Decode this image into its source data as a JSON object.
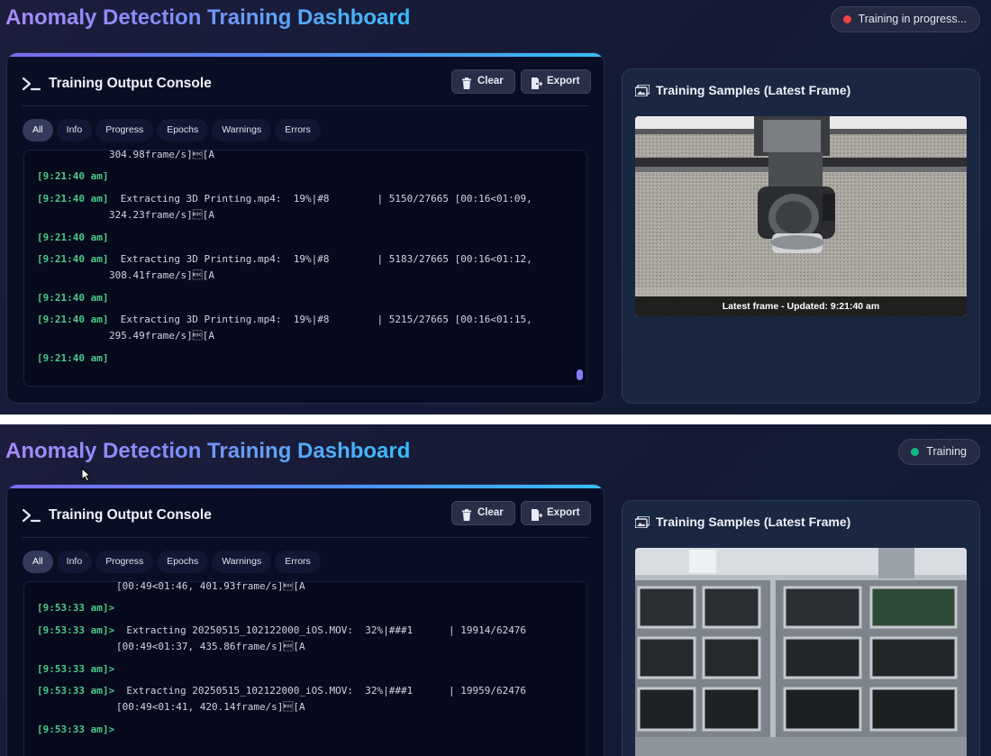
{
  "top": {
    "title": "Anomaly Detection Training Dashboard",
    "status": {
      "label": "Training in progress...",
      "dot_color": "#ef4444"
    },
    "console": {
      "title": "Training Output Console",
      "clear_label": "Clear",
      "export_label": "Export",
      "filters": [
        "All",
        "Info",
        "Progress",
        "Epochs",
        "Warnings",
        "Errors"
      ],
      "active_filter": "All",
      "lines": [
        {
          "ts": "",
          "text": "304.98frame/s]\u001b[A"
        },
        {
          "ts": "[9:21:40 am]",
          "text": ""
        },
        {
          "ts": "[9:21:40 am]",
          "text": "Extracting 3D Printing.mp4:  19%|#8        | 5150/27665 [00:16<01:09,"
        },
        {
          "ts": "",
          "text": "324.23frame/s]\u001b[A"
        },
        {
          "ts": "[9:21:40 am]",
          "text": ""
        },
        {
          "ts": "[9:21:40 am]",
          "text": "Extracting 3D Printing.mp4:  19%|#8        | 5183/27665 [00:16<01:12,"
        },
        {
          "ts": "",
          "text": "308.41frame/s]\u001b[A"
        },
        {
          "ts": "[9:21:40 am]",
          "text": ""
        },
        {
          "ts": "[9:21:40 am]",
          "text": "Extracting 3D Printing.mp4:  19%|#8        | 5215/27665 [00:16<01:15,"
        },
        {
          "ts": "",
          "text": "295.49frame/s]\u001b[A"
        },
        {
          "ts": "[9:21:40 am]",
          "text": ""
        }
      ]
    },
    "samples": {
      "title": "Training Samples (Latest Frame)",
      "caption": "Latest frame - Updated: 9:21:40 am"
    }
  },
  "bottom": {
    "title": "Anomaly Detection Training Dashboard",
    "status": {
      "label": "Training",
      "dot_color": "#10b981"
    },
    "console": {
      "title": "Training Output Console",
      "clear_label": "Clear",
      "export_label": "Export",
      "filters": [
        "All",
        "Info",
        "Progress",
        "Epochs",
        "Warnings",
        "Errors"
      ],
      "active_filter": "All",
      "lines": [
        {
          "ts": "",
          "text": "[00:49<01:46, 401.93frame/s]\u001b[A"
        },
        {
          "ts": "[9:53:33 am]>",
          "text": ""
        },
        {
          "ts": "[9:53:33 am]>",
          "text": "Extracting 20250515_102122000_iOS.MOV:  32%|###1      | 19914/62476"
        },
        {
          "ts": "",
          "text": "[00:49<01:37, 435.86frame/s]\u001b[A"
        },
        {
          "ts": "[9:53:33 am]>",
          "text": ""
        },
        {
          "ts": "[9:53:33 am]>",
          "text": "Extracting 20250515_102122000_iOS.MOV:  32%|###1      | 19959/62476"
        },
        {
          "ts": "",
          "text": "[00:49<01:41, 420.14frame/s]\u001b[A"
        },
        {
          "ts": "[9:53:33 am]>",
          "text": ""
        }
      ]
    },
    "samples": {
      "title": "Training Samples (Latest Frame)"
    }
  }
}
